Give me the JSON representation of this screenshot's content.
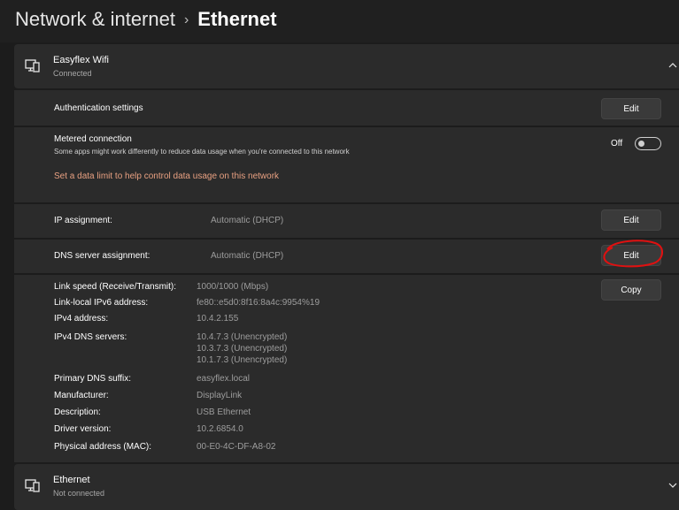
{
  "breadcrumb": {
    "parent": "Network & internet",
    "separator": "›",
    "current": "Ethernet"
  },
  "network_card": {
    "name": "Easyflex Wifi",
    "status": "Connected",
    "icon": "monitor-network-icon",
    "expand_icon": "chevron-up-icon"
  },
  "authentication": {
    "label": "Authentication settings",
    "button": "Edit"
  },
  "metered": {
    "label": "Metered connection",
    "description": "Some apps might work differently to reduce data usage when you're connected to this network",
    "toggle_state": "Off",
    "link": "Set a data limit to help control data usage on this network"
  },
  "ip_assignment": {
    "label": "IP assignment:",
    "value": "Automatic (DHCP)",
    "button": "Edit"
  },
  "dns_assignment": {
    "label": "DNS server assignment:",
    "value": "Automatic (DHCP)",
    "button": "Edit"
  },
  "properties": {
    "copy_button": "Copy",
    "items": [
      {
        "label": "Link speed (Receive/Transmit):",
        "value": "1000/1000 (Mbps)"
      },
      {
        "label": "Link-local IPv6 address:",
        "value": "fe80::e5d0:8f16:8a4c:9954%19"
      },
      {
        "label": "IPv4 address:",
        "value": "10.4.2.155"
      },
      {
        "label": "IPv4 DNS servers:",
        "values": [
          "10.4.7.3 (Unencrypted)",
          "10.3.7.3 (Unencrypted)",
          "10.1.7.3 (Unencrypted)"
        ]
      },
      {
        "label": "Primary DNS suffix:",
        "value": "easyflex.local"
      },
      {
        "label": "Manufacturer:",
        "value": "DisplayLink"
      },
      {
        "label": "Description:",
        "value": "USB Ethernet"
      },
      {
        "label": "Driver version:",
        "value": "10.2.6854.0"
      },
      {
        "label": "Physical address (MAC):",
        "value": "00-E0-4C-DF-A8-02"
      }
    ]
  },
  "ethernet_card": {
    "name": "Ethernet",
    "status": "Not connected",
    "icon": "monitor-network-icon",
    "expand_icon": "chevron-down-icon"
  },
  "colors": {
    "background": "#1c1c1c",
    "card": "#2b2b2b",
    "link": "#e8a081",
    "annotation": "#e01010"
  }
}
